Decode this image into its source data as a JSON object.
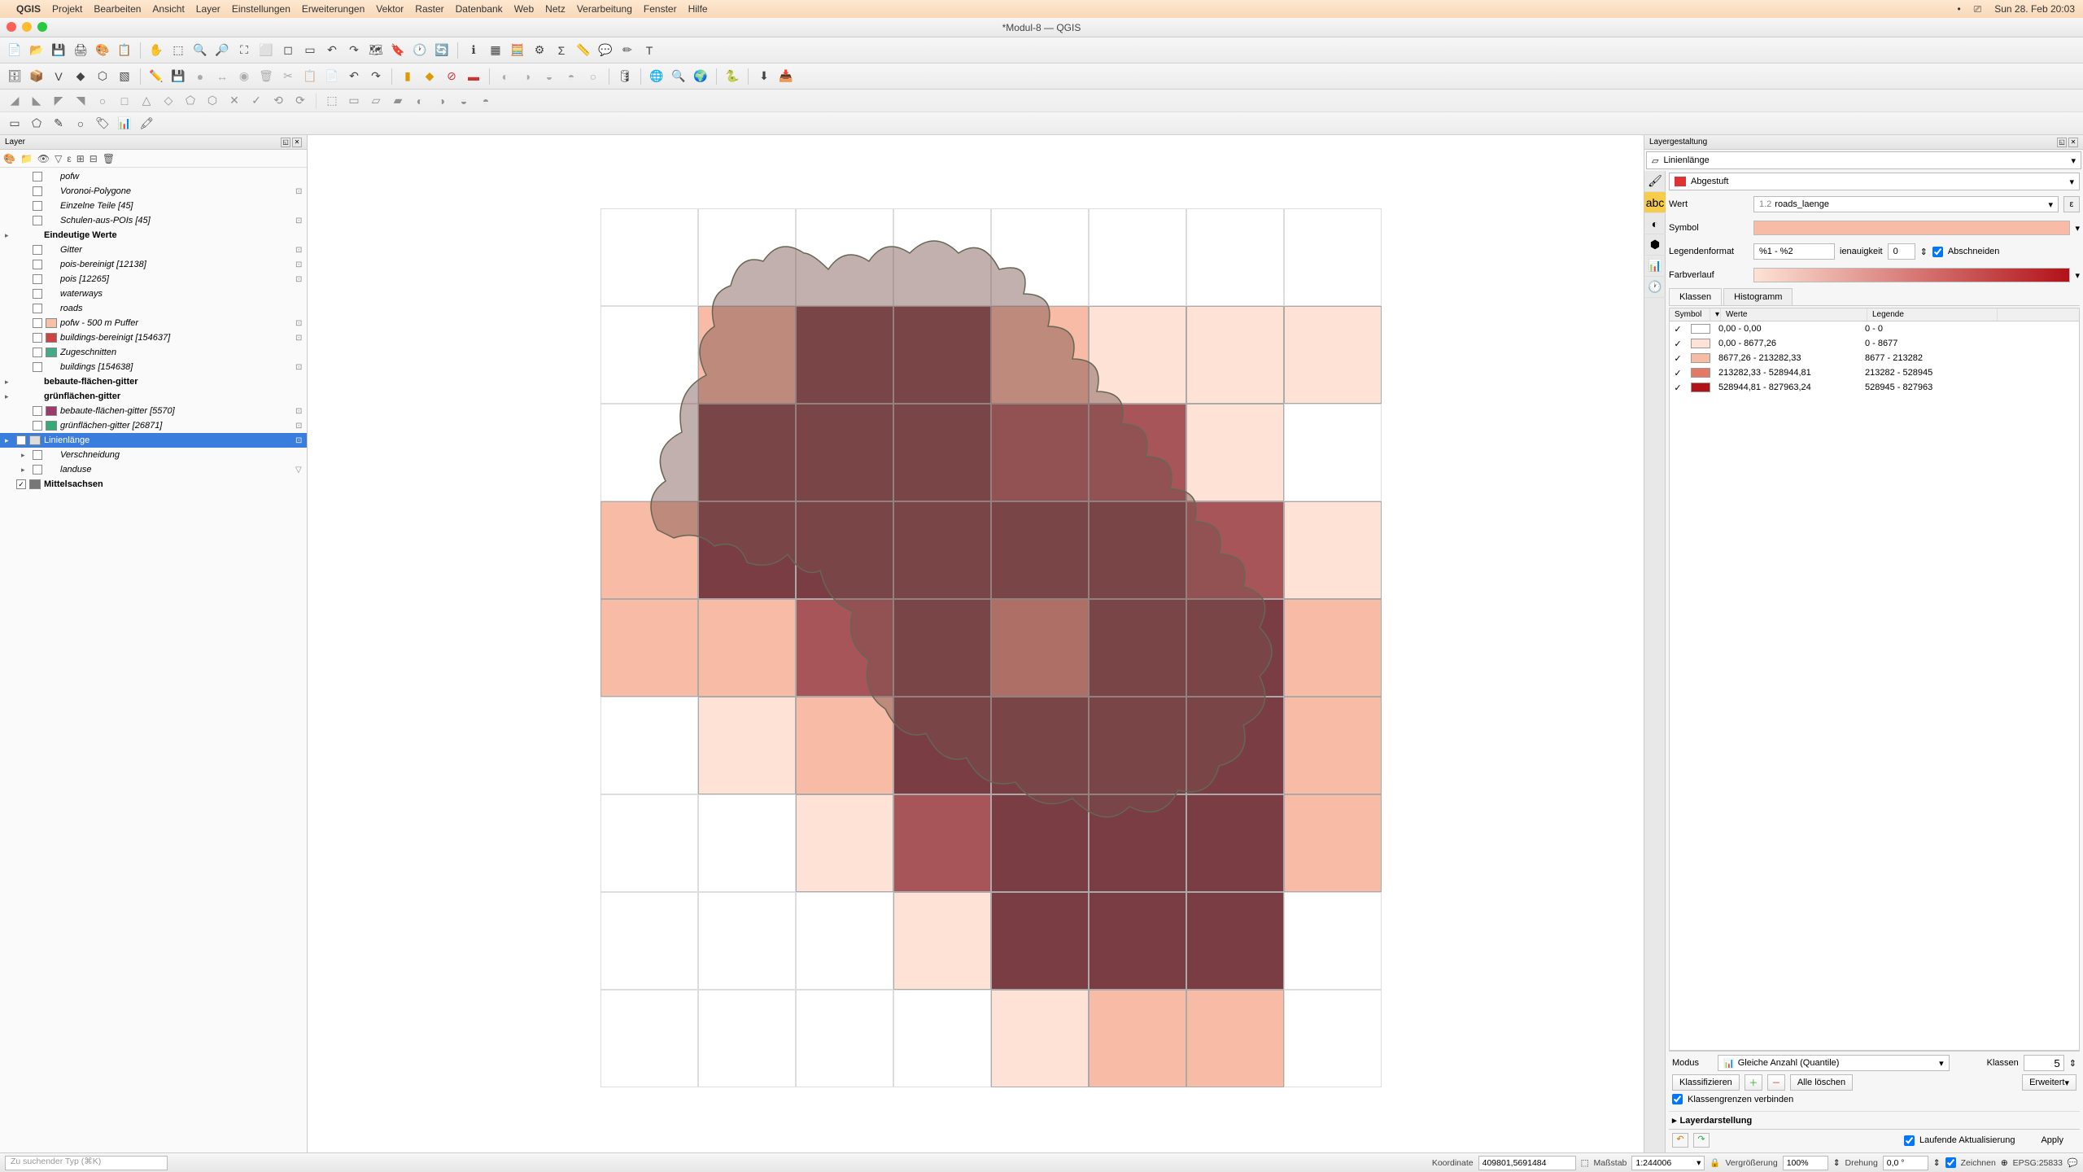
{
  "mac_menu": {
    "app": "QGIS",
    "items": [
      "Projekt",
      "Bearbeiten",
      "Ansicht",
      "Layer",
      "Einstellungen",
      "Erweiterungen",
      "Vektor",
      "Raster",
      "Datenbank",
      "Web",
      "Netz",
      "Verarbeitung",
      "Fenster",
      "Hilfe"
    ],
    "clock": "Sun 28. Feb  20:03"
  },
  "window_title": "*Modul-8 — QGIS",
  "layers_panel": {
    "title": "Layer",
    "layers": [
      {
        "indent": 1,
        "checked": false,
        "swatch": null,
        "name": "pofw",
        "bold": false,
        "italic": true
      },
      {
        "indent": 1,
        "checked": false,
        "swatch": null,
        "name": "Voronoi-Polygone",
        "bold": false,
        "italic": true,
        "count": true
      },
      {
        "indent": 1,
        "checked": false,
        "swatch": null,
        "name": "Einzelne Teile [45]",
        "bold": false,
        "italic": true
      },
      {
        "indent": 1,
        "checked": false,
        "swatch": null,
        "name": "Schulen-aus-POIs [45]",
        "bold": false,
        "italic": true,
        "count": true
      },
      {
        "indent": 0,
        "checked": null,
        "swatch": null,
        "name": "Eindeutige Werte",
        "bold": true,
        "italic": false,
        "arrow": "▸"
      },
      {
        "indent": 1,
        "checked": false,
        "swatch": null,
        "name": "Gitter",
        "bold": false,
        "italic": true,
        "count": true
      },
      {
        "indent": 1,
        "checked": false,
        "swatch": null,
        "name": "pois-bereinigt [12138]",
        "bold": false,
        "italic": true,
        "count": true
      },
      {
        "indent": 1,
        "checked": false,
        "swatch": null,
        "name": "pois [12265]",
        "bold": false,
        "italic": true,
        "count": true
      },
      {
        "indent": 1,
        "checked": false,
        "swatch": null,
        "name": "waterways",
        "bold": false,
        "italic": true
      },
      {
        "indent": 1,
        "checked": false,
        "swatch": null,
        "name": "roads",
        "bold": false,
        "italic": true
      },
      {
        "indent": 1,
        "checked": false,
        "swatch": "#f5c2a8",
        "name": "pofw - 500 m Puffer",
        "bold": false,
        "italic": true,
        "count": true
      },
      {
        "indent": 1,
        "checked": false,
        "swatch": "#c44",
        "name": "buildings-bereinigt [154637]",
        "bold": false,
        "italic": true,
        "count": true
      },
      {
        "indent": 1,
        "checked": false,
        "swatch": "#4a8",
        "name": "Zugeschnitten",
        "bold": false,
        "italic": true
      },
      {
        "indent": 1,
        "checked": false,
        "swatch": null,
        "name": "buildings [154638]",
        "bold": false,
        "italic": true,
        "count": true
      },
      {
        "indent": 0,
        "checked": null,
        "swatch": null,
        "name": "bebaute-flächen-gitter",
        "bold": true,
        "italic": false,
        "arrow": "▸"
      },
      {
        "indent": 0,
        "checked": null,
        "swatch": null,
        "name": "grünflächen-gitter",
        "bold": true,
        "italic": false,
        "arrow": "▸"
      },
      {
        "indent": 1,
        "checked": false,
        "swatch": "#9b3a6b",
        "name": "bebaute-flächen-gitter [5570]",
        "bold": false,
        "italic": true,
        "count": true
      },
      {
        "indent": 1,
        "checked": false,
        "swatch": "#3a7",
        "name": "grünflächen-gitter [26871]",
        "bold": false,
        "italic": true,
        "count": true
      },
      {
        "indent": 0,
        "checked": true,
        "swatch": "#ddd",
        "name": "Linienlänge",
        "bold": false,
        "italic": false,
        "selected": true,
        "arrow": "▸",
        "count": true
      },
      {
        "indent": 1,
        "checked": false,
        "swatch": null,
        "name": "Verschneidung",
        "bold": false,
        "italic": true,
        "arrow": "▸"
      },
      {
        "indent": 1,
        "checked": false,
        "swatch": null,
        "name": "landuse",
        "bold": false,
        "italic": true,
        "arrow": "▸",
        "filt": true
      },
      {
        "indent": 0,
        "checked": true,
        "swatch": "#777",
        "name": "Mittelsachsen",
        "bold": true,
        "italic": false
      }
    ]
  },
  "map_grid_classes": [
    [
      0,
      0,
      0,
      0,
      0,
      0,
      0,
      0
    ],
    [
      0,
      2,
      5,
      5,
      2,
      1,
      1,
      1
    ],
    [
      0,
      5,
      5,
      5,
      4,
      4,
      1,
      0
    ],
    [
      2,
      5,
      5,
      5,
      5,
      5,
      4,
      1
    ],
    [
      2,
      2,
      4,
      5,
      3,
      5,
      5,
      2
    ],
    [
      0,
      1,
      2,
      5,
      5,
      5,
      5,
      2
    ],
    [
      0,
      0,
      1,
      4,
      5,
      5,
      5,
      2
    ],
    [
      0,
      0,
      0,
      1,
      5,
      5,
      5,
      0
    ],
    [
      0,
      0,
      0,
      0,
      1,
      2,
      2,
      0
    ]
  ],
  "styling": {
    "title": "Layergestaltung",
    "layer": "Linienlänge",
    "renderer": "Abgestuft",
    "value_label": "Wert",
    "value_field": "roads_laenge",
    "symbol_label": "Symbol",
    "legend_label": "Legendenformat",
    "legend_format": "%1 - %2",
    "precision_label": "ienauigkeit",
    "precision_value": "0",
    "trim_label": "Abschneiden",
    "ramp_label": "Farbverlauf",
    "tabs": {
      "classes": "Klassen",
      "histogram": "Histogramm"
    },
    "table_head": {
      "symbol": "Symbol",
      "values": "Werte",
      "legend": "Legende"
    },
    "classes": [
      {
        "color": "#ffffff",
        "values": "0,00 - 0,00",
        "legend": "0 - 0"
      },
      {
        "color": "#fde2d5",
        "values": "0,00 - 8677,26",
        "legend": "0 - 8677"
      },
      {
        "color": "#f8bba5",
        "values": "8677,26 - 213282,33",
        "legend": "8677 - 213282"
      },
      {
        "color": "#e47a66",
        "values": "213282,33 - 528944,81",
        "legend": "213282 - 528945"
      },
      {
        "color": "#b11218",
        "values": "528944,81 - 827963,24",
        "legend": "528945 - 827963"
      }
    ],
    "mode_label": "Modus",
    "mode_value": "Gleiche Anzahl (Quantile)",
    "classes_label": "Klassen",
    "classes_count": "5",
    "classify_btn": "Klassifizieren",
    "delete_all_btn": "Alle löschen",
    "advanced_btn": "Erweitert",
    "link_boundaries": "Klassengrenzen verbinden",
    "layer_rendering": "Layerdarstellung",
    "live_update": "Laufende Aktualisierung",
    "apply_btn": "Apply"
  },
  "statusbar": {
    "search_placeholder": "Zu suchender Typ (⌘K)",
    "coord_label": "Koordinate",
    "coord_value": "409801,5691484",
    "scale_label": "Maßstab",
    "scale_value": "1:244006",
    "mag_label": "Vergrößerung",
    "mag_value": "100%",
    "rot_label": "Drehung",
    "rot_value": "0,0 °",
    "render_label": "Zeichnen",
    "crs": "EPSG:25833"
  }
}
